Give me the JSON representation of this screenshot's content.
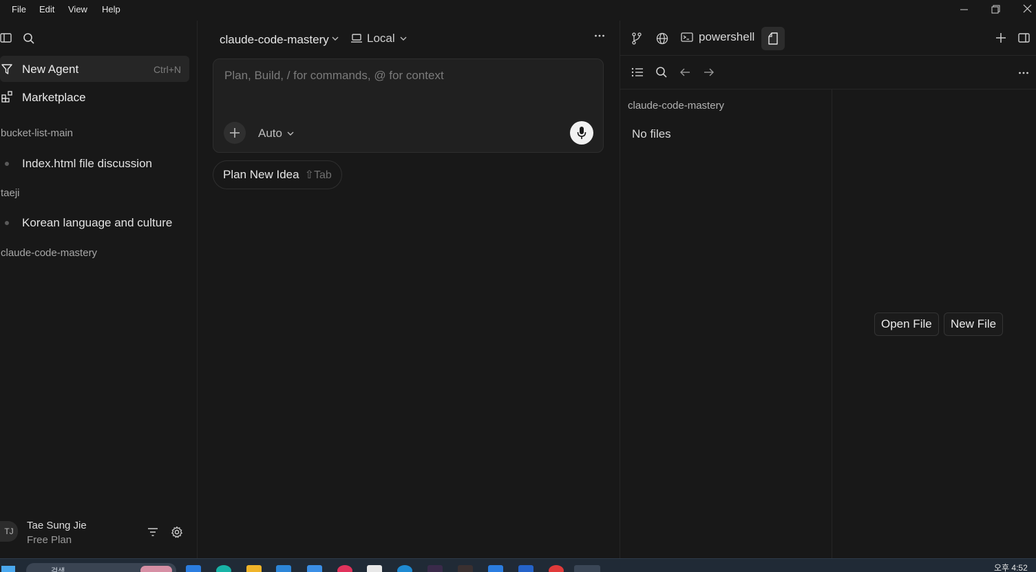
{
  "menu": {
    "file": "File",
    "edit": "Edit",
    "view": "View",
    "help": "Help"
  },
  "sidebar": {
    "nav": [
      {
        "label": "New Agent",
        "shortcut": "Ctrl+N"
      },
      {
        "label": "Marketplace"
      }
    ],
    "groups": [
      {
        "name": "bucket-list-main",
        "chats": [
          "Index.html file discussion"
        ]
      },
      {
        "name": "taeji",
        "chats": [
          "Korean language and culture"
        ]
      },
      {
        "name": "claude-code-mastery",
        "chats": []
      }
    ],
    "user": {
      "initials": "TJ",
      "name": "Tae Sung Jie",
      "plan": "Free Plan"
    }
  },
  "main": {
    "repo": "claude-code-mastery",
    "location": "Local",
    "composer": {
      "placeholder": "Plan, Build, / for commands, @ for context",
      "mode": "Auto"
    },
    "plan_chip": {
      "label": "Plan New Idea",
      "shortcut": "⇧Tab"
    }
  },
  "right": {
    "terminal_tab": "powershell",
    "files": {
      "root": "claude-code-mastery",
      "empty": "No files"
    },
    "buttons": {
      "open_file": "Open File",
      "new_file": "New File"
    }
  },
  "taskbar": {
    "search": "검색",
    "time": "오후 4:52"
  }
}
